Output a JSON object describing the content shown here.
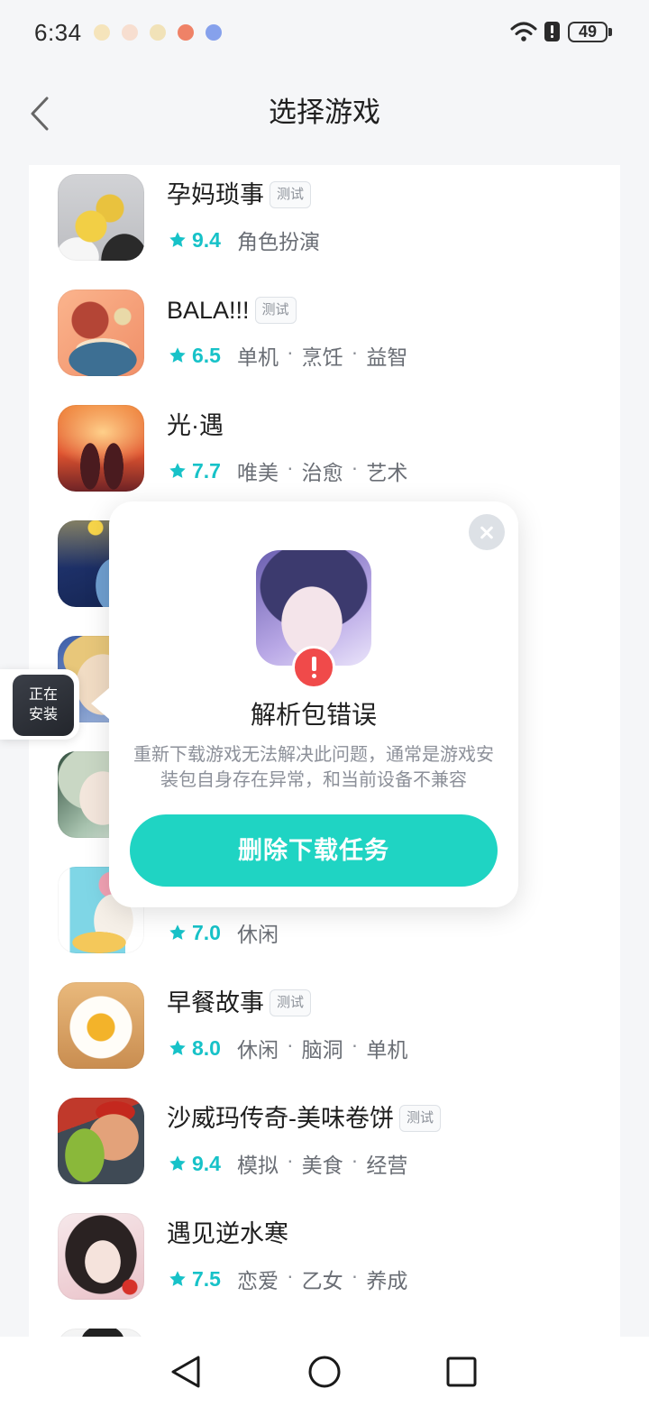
{
  "status_bar": {
    "time": "6:34",
    "battery_level": "49",
    "notification_icons": [
      {
        "name": "app-notification-icon",
        "color": "#f5e2b4"
      },
      {
        "name": "app-notification-icon",
        "color": "#f7dccb"
      },
      {
        "name": "app-notification-icon",
        "color": "#f1e0b0"
      },
      {
        "name": "app-notification-icon",
        "color": "#ee7556"
      },
      {
        "name": "app-notification-icon",
        "color": "#7a98ea"
      }
    ],
    "system_icons": [
      "wifi-icon",
      "alert-icon",
      "battery-icon"
    ]
  },
  "header": {
    "back_icon": "chevron-left-icon",
    "title": "选择游戏"
  },
  "game_list": {
    "tag_separator": "·",
    "rating_icon": "star-icon",
    "items": [
      {
        "title": "孕妈琐事",
        "badge": "测试",
        "rating": "9.4",
        "tags": [
          "角色扮演"
        ]
      },
      {
        "title": "BALA!!!",
        "badge": "测试",
        "rating": "6.5",
        "tags": [
          "单机",
          "烹饪",
          "益智"
        ]
      },
      {
        "title": "光·遇",
        "rating": "7.7",
        "tags": [
          "唯美",
          "治愈",
          "艺术"
        ]
      },
      {},
      {},
      {},
      {
        "rating": "7.0",
        "tags": [
          "休闲"
        ]
      },
      {
        "title": "早餐故事",
        "badge": "测试",
        "rating": "8.0",
        "tags": [
          "休闲",
          "脑洞",
          "单机"
        ]
      },
      {
        "title": "沙威玛传奇-美味卷饼",
        "badge": "测试",
        "rating": "9.4",
        "tags": [
          "模拟",
          "美食",
          "经营"
        ]
      },
      {
        "title": "遇见逆水寒",
        "rating": "7.5",
        "tags": [
          "恋爱",
          "乙女",
          "养成"
        ]
      },
      {}
    ]
  },
  "installing_widget": {
    "label_lines": [
      "正在",
      "安装"
    ]
  },
  "dialog": {
    "close_icon": "close-icon",
    "status_icon": "exclamation-icon",
    "title": "解析包错误",
    "description": "重新下载游戏无法解决此问题，通常是游戏安装包自身存在异常，和当前设备不兼容",
    "action_label": "删除下载任务"
  },
  "nav_bar": {
    "icons": [
      "back-icon",
      "home-icon",
      "recents-icon"
    ]
  },
  "colors": {
    "accent": "#1fd4c3",
    "rating": "#17c2c8",
    "error": "#f04a4a"
  }
}
